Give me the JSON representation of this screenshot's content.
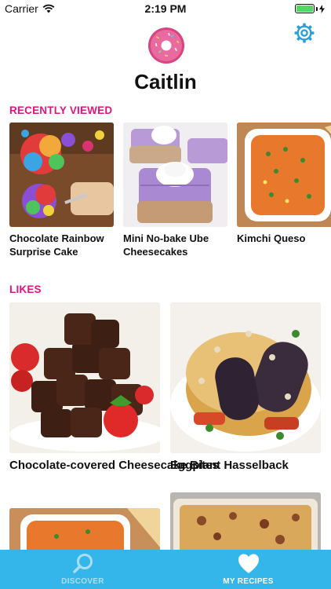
{
  "status_bar": {
    "carrier": "Carrier",
    "time": "2:19 PM",
    "battery_level": 1.0
  },
  "profile": {
    "name": "Caitlin",
    "avatar_icon": "donut-avatar-icon",
    "settings_icon": "gear-icon"
  },
  "recently_viewed": {
    "title": "RECENTLY VIEWED",
    "items": [
      {
        "title": "Chocolate Rainbow Surprise Cake"
      },
      {
        "title": "Mini No-bake Ube Cheesecakes"
      },
      {
        "title": "Kimchi Queso"
      }
    ]
  },
  "likes": {
    "title": "LIKES",
    "items": [
      {
        "title": "Chocolate-covered Cheesecake Bites"
      },
      {
        "title": "Eggplant Hasselback"
      }
    ]
  },
  "tab_bar": {
    "tabs": [
      {
        "label": "DISCOVER",
        "icon": "search-icon",
        "active": false
      },
      {
        "label": "MY RECIPES",
        "icon": "heart-icon",
        "active": true
      }
    ]
  },
  "colors": {
    "accent_pink": "#e0157a",
    "tab_bar_blue": "#35b6ea",
    "settings_blue": "#2a9fd8"
  }
}
